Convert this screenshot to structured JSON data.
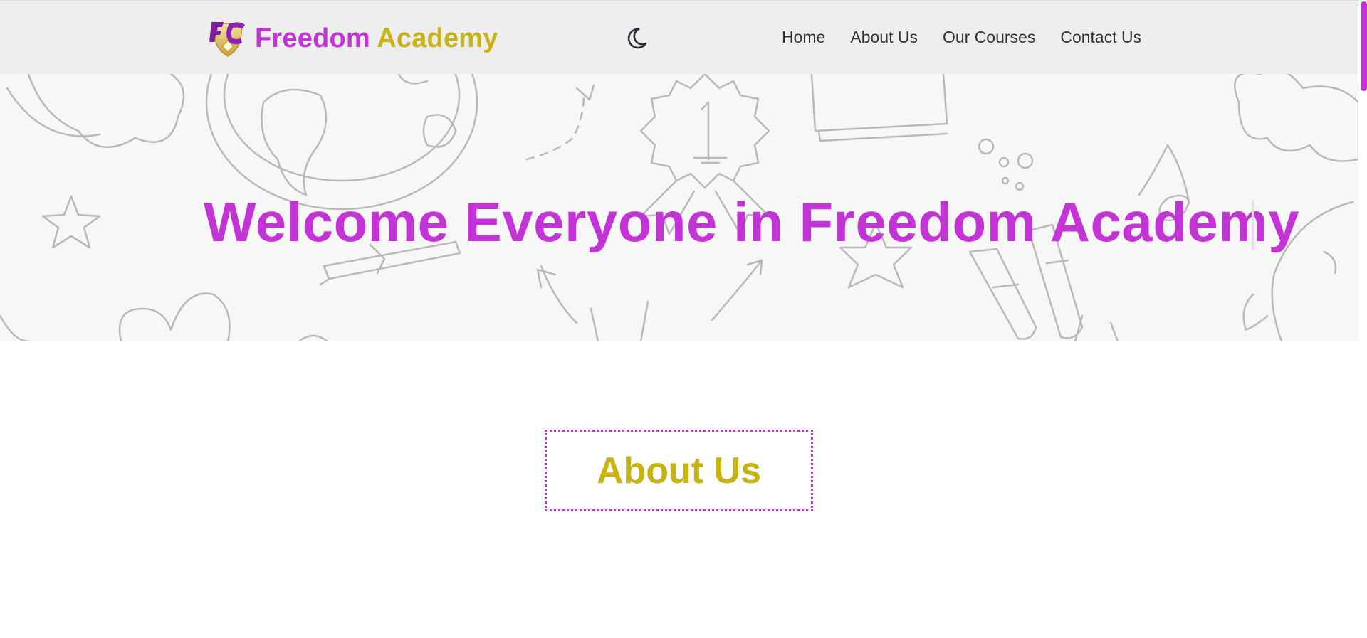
{
  "brand": {
    "name_part1": "Freedom",
    "name_part2": "Academy",
    "logo_letters": "FC"
  },
  "header": {
    "theme_toggle_icon": "moon-icon",
    "nav": [
      {
        "label": "Home"
      },
      {
        "label": "About Us"
      },
      {
        "label": "Our Courses"
      },
      {
        "label": "Contact Us"
      }
    ]
  },
  "hero": {
    "title": "Welcome Everyone in Freedom Academy",
    "badge_number": "1"
  },
  "about": {
    "title": "About Us"
  },
  "colors": {
    "primary": "#c433d6",
    "accent": "#c9b312",
    "header_bg": "#eeeeee",
    "nav_text": "#333333"
  }
}
